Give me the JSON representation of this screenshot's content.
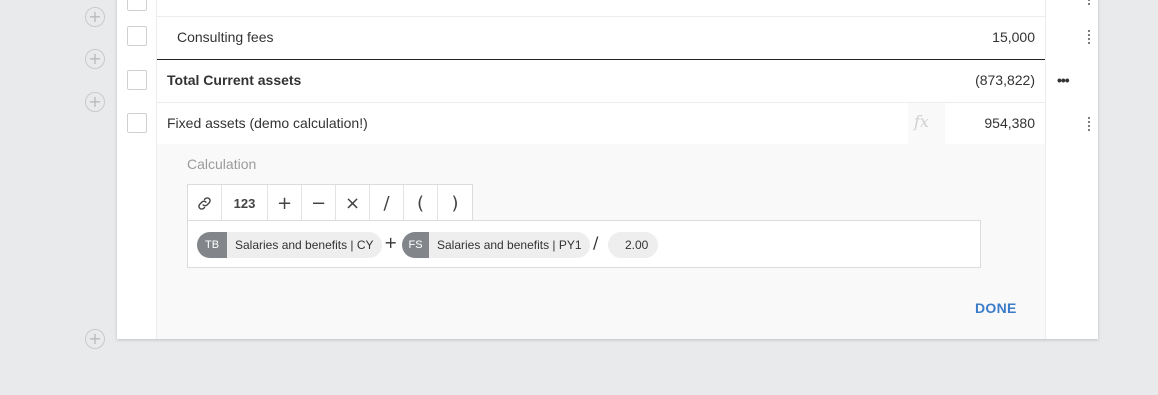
{
  "rows": [
    {
      "label": "Consulting fees",
      "value": "15,000"
    },
    {
      "label": "Total Current assets",
      "value": "(873,822)"
    },
    {
      "label": "Fixed assets (demo calculation!)",
      "value": "954,380"
    }
  ],
  "icons": {
    "add": "plus-circle-icon",
    "drag": "drag-handle-icon",
    "more": "more-horizontal-icon",
    "fx": "formula-icon",
    "link": "link-icon"
  },
  "glyphs": {
    "add": "+",
    "more": "•••",
    "fx": "fx"
  },
  "calculation": {
    "title": "Calculation",
    "toolbar": [
      {
        "name": "link-button",
        "label": "⛓"
      },
      {
        "name": "number-button",
        "label": "123"
      },
      {
        "name": "plus-button",
        "label": "+"
      },
      {
        "name": "minus-button",
        "label": "−"
      },
      {
        "name": "multiply-button",
        "label": "×"
      },
      {
        "name": "divide-button",
        "label": "/"
      },
      {
        "name": "open-paren-button",
        "label": "("
      },
      {
        "name": "close-paren-button",
        "label": ")"
      }
    ],
    "formula": {
      "chip1": {
        "badge": "TB",
        "label": "Salaries and benefits | CY"
      },
      "op1": "+",
      "chip2": {
        "badge": "FS",
        "label": "Salaries and benefits | PY1"
      },
      "op2": "/",
      "number": "2.00"
    },
    "done_label": "DONE"
  },
  "colors": {
    "accent": "#3b7bc8",
    "badge": "#82868a",
    "background": "#e9eaeb"
  }
}
